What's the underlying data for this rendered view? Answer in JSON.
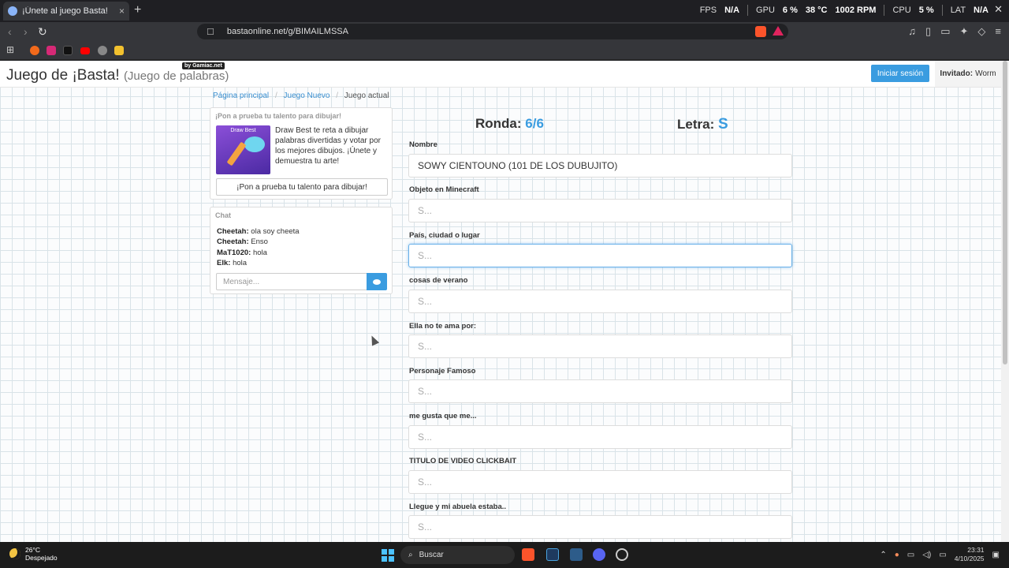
{
  "browser": {
    "tab_title": "¡Únete al juego Basta!",
    "tab_close": "×",
    "new_tab": "+",
    "url": "bastaonline.net/g/BIMAILMSSA",
    "perf": {
      "fps_label": "FPS",
      "fps_value": "N/A",
      "gpu_label": "GPU",
      "gpu_value": "6 %",
      "gpu_temp": "38 °C",
      "gpu_rpm": "1002 RPM",
      "cpu_label": "CPU",
      "cpu_value": "5 %",
      "lat_label": "LAT",
      "lat_value": "N/A"
    }
  },
  "header": {
    "title": "Juego de ¡Basta!",
    "subtitle": "(Juego de palabras)",
    "badge": "by Gamiac.net",
    "login": "Iniciar sesión",
    "guest_label": "Invitado:",
    "guest_name": "Worm"
  },
  "breadcrumb": {
    "home": "Página principal",
    "new_game": "Juego Nuevo",
    "current": "Juego actual",
    "separator": "/"
  },
  "promo": {
    "heading": "¡Pon a prueba tu talento para dibujar!",
    "image_caption": "Draw Best",
    "text": "Draw Best te reta a dibujar palabras divertidas y votar por los mejores dibujos. ¡Únete y demuestra tu arte!",
    "button": "¡Pon a prueba tu talento para dibujar!"
  },
  "chat": {
    "heading": "Chat",
    "messages": [
      {
        "user": "Cheetah:",
        "text": "ola soy cheeta"
      },
      {
        "user": "Cheetah:",
        "text": "Enso"
      },
      {
        "user": "MaT1020:",
        "text": "hola"
      },
      {
        "user": "Elk:",
        "text": "hola"
      }
    ],
    "input_placeholder": "Mensaje..."
  },
  "game": {
    "round_label": "Ronda:",
    "round_value": "6/6",
    "letter_label": "Letra:",
    "letter_value": "S",
    "fields": [
      {
        "label": "Nombre",
        "value": "SOWY CIENTOUNO (101 DE LOS DUBUJITO)",
        "placeholder": ""
      },
      {
        "label": "Objeto en Minecraft",
        "value": "",
        "placeholder": "S..."
      },
      {
        "label": "País, ciudad o lugar",
        "value": "",
        "placeholder": "S..."
      },
      {
        "label": "cosas de verano",
        "value": "",
        "placeholder": "S..."
      },
      {
        "label": "Ella no te ama por:",
        "value": "",
        "placeholder": "S..."
      },
      {
        "label": "Personaje Famoso",
        "value": "",
        "placeholder": "S..."
      },
      {
        "label": "me gusta que me...",
        "value": "",
        "placeholder": "S..."
      },
      {
        "label": "TITULO DE VIDEO CLICKBAIT",
        "value": "",
        "placeholder": "S..."
      },
      {
        "label": "Llegue y mi abuela estaba..",
        "value": "",
        "placeholder": "S..."
      }
    ]
  },
  "taskbar": {
    "temp": "26°C",
    "weather": "Despejado",
    "search": "Buscar",
    "time": "23:31",
    "date": "4/10/2025"
  },
  "colors": {
    "accent": "#3a9ce0",
    "focus": "#66afe9"
  }
}
